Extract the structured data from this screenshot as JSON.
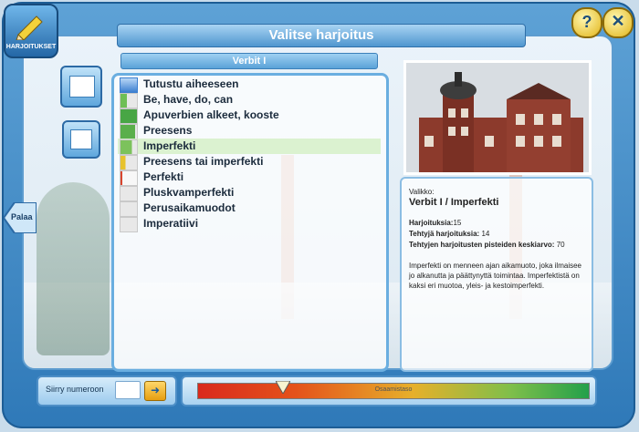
{
  "header": {
    "title": "Valitse harjoitus",
    "subtitle": "Verbit I",
    "logo_label": "HARJOITUKSET"
  },
  "nav": {
    "back_label": "Palaa",
    "help_icon": "question-icon",
    "close_icon": "close-icon"
  },
  "list": {
    "items": [
      {
        "label": "Tutustu aiheeseen",
        "icon": "star-icon",
        "progress": 0
      },
      {
        "label": "Be, have, do, can",
        "progress": 0.4
      },
      {
        "label": "Apuverbien alkeet, kooste",
        "progress": 1.0
      },
      {
        "label": "Preesens",
        "progress": 0.9
      },
      {
        "label": "Imperfekti",
        "progress": 0.7,
        "selected": true
      },
      {
        "label": "Preesens tai imperfekti",
        "progress": 0.3
      },
      {
        "label": "Perfekti",
        "progress": 0.1
      },
      {
        "label": "Pluskvamperfekti",
        "progress": 0
      },
      {
        "label": "Perusaikamuodot",
        "progress": 0
      },
      {
        "label": "Imperatiivi",
        "progress": 0
      }
    ]
  },
  "info": {
    "menu_label": "Valikko:",
    "menu_path": "Verbit I / Imperfekti",
    "exercises_label": "Harjoituksia:",
    "exercises_value": "15",
    "done_label": "Tehtyjä harjoituksia:",
    "done_value": "14",
    "avg_label": "Tehtyjen harjoitusten pisteiden keskiarvo:",
    "avg_value": "70",
    "description": "Imperfekti on menneen ajan aikamuoto, joka ilmaisee jo alkanutta ja päättynyttä toimintaa. Imperfektistä on kaksi eri muotoa, yleis- ja kestoimperfekti."
  },
  "footer": {
    "goto_label": "Siirry numeroon",
    "goto_value": "",
    "meter_label": "Osaamistaso",
    "meter_level": 0.22
  },
  "colors": {
    "accent": "#2f79b8",
    "selected_row": "#d6f0c8"
  }
}
